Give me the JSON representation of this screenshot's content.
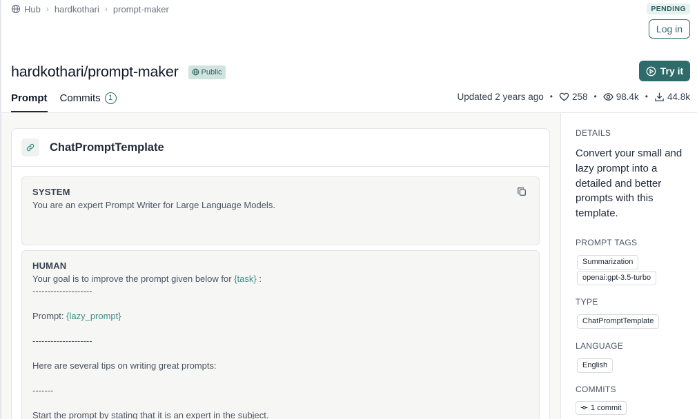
{
  "breadcrumb": {
    "items": [
      "Hub",
      "hardkothari",
      "prompt-maker"
    ],
    "icon": "globe-icon"
  },
  "status_badge": "PENDING",
  "login_label": "Log in",
  "repo": {
    "title": "hardkothari/prompt-maker",
    "visibility": "Public"
  },
  "try_label": "Try it",
  "tabs": [
    {
      "label": "Prompt",
      "active": true
    },
    {
      "label": "Commits",
      "count": "1",
      "active": false
    }
  ],
  "stats": {
    "updated": "Updated 2 years ago",
    "likes": "258",
    "views": "98.4k",
    "downloads": "44.8k"
  },
  "card": {
    "title": "ChatPromptTemplate",
    "messages": [
      {
        "role": "SYSTEM",
        "text": "You are an expert Prompt Writer for Large Language Models."
      },
      {
        "role": "HUMAN",
        "line1_prefix": "Your goal is to improve the prompt given below for ",
        "line1_var": "{task}",
        "line1_suffix": " :",
        "line2": "--------------------",
        "line3_prefix": "Prompt: ",
        "line3_var": "{lazy_prompt}",
        "line4": "--------------------",
        "line5": "Here are several tips on writing great prompts:",
        "line6": "-------",
        "line7": "Start the prompt by stating that it is an expert in the subject."
      }
    ]
  },
  "sidebar": {
    "details_label": "DETAILS",
    "description": "Convert your small and lazy prompt into a detailed and better prompts with this template.",
    "tags_label": "PROMPT TAGS",
    "tags": [
      "Summarization",
      "openai:gpt-3.5-turbo"
    ],
    "type_label": "TYPE",
    "type_value": "ChatPromptTemplate",
    "language_label": "LANGUAGE",
    "language_value": "English",
    "commits_label": "COMMITS",
    "commits_value": "1 commit"
  },
  "colors": {
    "accent": "#2f6b6b",
    "variable": "#3f8f87",
    "badge_bg": "#cfe4e1"
  }
}
